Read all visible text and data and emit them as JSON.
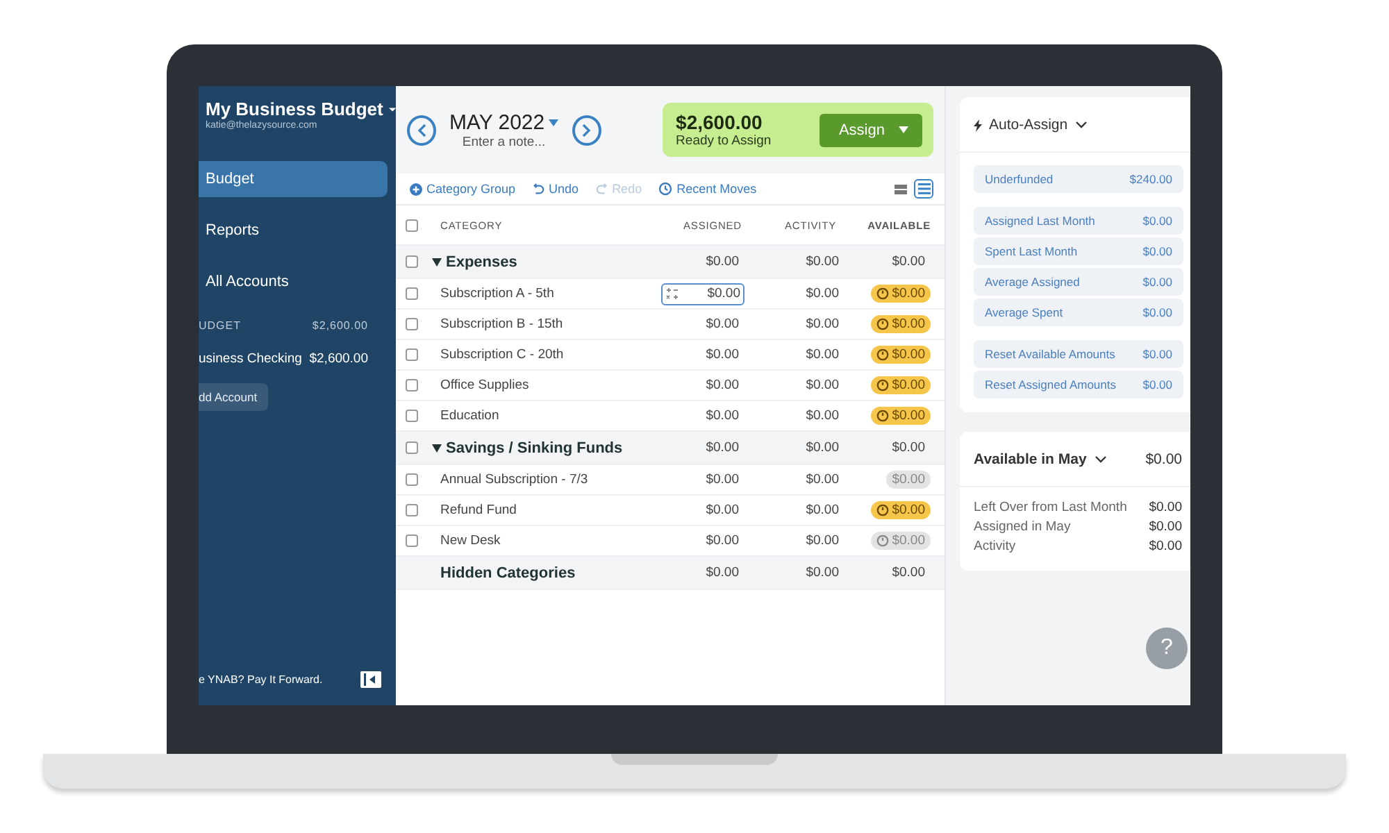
{
  "sidebar": {
    "budget_name": "My Business Budget",
    "email": "katie@thelazysource.com",
    "nav": [
      {
        "label": "Budget",
        "selected": true
      },
      {
        "label": "Reports",
        "selected": false
      },
      {
        "label": "All Accounts",
        "selected": false
      }
    ],
    "section": {
      "label": "UDGET",
      "amount": "$2,600.00"
    },
    "accounts": [
      {
        "name": "usiness Checking",
        "balance": "$2,600.00"
      }
    ],
    "add_account": "dd Account",
    "footer": "e YNAB? Pay It Forward."
  },
  "header": {
    "month": "MAY 2022",
    "note_placeholder": "Enter a note...",
    "ready_amount": "$2,600.00",
    "ready_label": "Ready to Assign",
    "assign_button": "Assign"
  },
  "toolbar": {
    "actions": [
      {
        "kind": "add",
        "label": "Category Group",
        "disabled": false
      },
      {
        "kind": "undo",
        "label": "Undo",
        "disabled": false
      },
      {
        "kind": "redo",
        "label": "Redo",
        "disabled": true
      },
      {
        "kind": "history",
        "label": "Recent Moves",
        "disabled": false
      }
    ],
    "view_toggles": [
      {
        "selected": false
      },
      {
        "selected": true
      }
    ]
  },
  "table": {
    "select_all_checked": false,
    "columns": [
      "CATEGORY",
      "ASSIGNED",
      "ACTIVITY",
      "AVAILABLE"
    ],
    "groups": [
      {
        "name": "Expenses",
        "expanded": true,
        "checked": false,
        "assigned": "$0.00",
        "activity": "$0.00",
        "available": "$0.00",
        "rows": [
          {
            "name": "Subscription A - 5th",
            "checked": false,
            "editing": true,
            "assigned": "$0.00",
            "activity": "$0.00",
            "available": "$0.00",
            "kind": "warning"
          },
          {
            "name": "Subscription B - 15th",
            "checked": false,
            "editing": false,
            "assigned": "$0.00",
            "activity": "$0.00",
            "available": "$0.00",
            "kind": "warning"
          },
          {
            "name": "Subscription C - 20th",
            "checked": false,
            "editing": false,
            "assigned": "$0.00",
            "activity": "$0.00",
            "available": "$0.00",
            "kind": "warning"
          },
          {
            "name": "Office Supplies",
            "checked": false,
            "editing": false,
            "assigned": "$0.00",
            "activity": "$0.00",
            "available": "$0.00",
            "kind": "warning"
          },
          {
            "name": "Education",
            "checked": false,
            "editing": false,
            "assigned": "$0.00",
            "activity": "$0.00",
            "available": "$0.00",
            "kind": "warning"
          }
        ]
      },
      {
        "name": "Savings / Sinking Funds",
        "expanded": true,
        "checked": false,
        "assigned": "$0.00",
        "activity": "$0.00",
        "available": "$0.00",
        "rows": [
          {
            "name": "Annual Subscription - 7/3",
            "checked": false,
            "editing": false,
            "assigned": "$0.00",
            "activity": "$0.00",
            "available": "$0.00",
            "kind": "muted"
          },
          {
            "name": "Refund Fund",
            "checked": false,
            "editing": false,
            "assigned": "$0.00",
            "activity": "$0.00",
            "available": "$0.00",
            "kind": "warning"
          },
          {
            "name": "New Desk",
            "checked": false,
            "editing": false,
            "assigned": "$0.00",
            "activity": "$0.00",
            "available": "$0.00",
            "kind": "muted-timer"
          }
        ]
      }
    ],
    "hidden": {
      "name": "Hidden Categories",
      "assigned": "$0.00",
      "activity": "$0.00",
      "available": "$0.00"
    }
  },
  "auto_assign": {
    "title": "Auto-Assign",
    "groups": [
      [
        {
          "label": "Underfunded",
          "amount": "$240.00"
        }
      ],
      [
        {
          "label": "Assigned Last Month",
          "amount": "$0.00"
        },
        {
          "label": "Spent Last Month",
          "amount": "$0.00"
        },
        {
          "label": "Average Assigned",
          "amount": "$0.00"
        },
        {
          "label": "Average Spent",
          "amount": "$0.00"
        }
      ],
      [
        {
          "label": "Reset Available Amounts",
          "amount": "$0.00"
        },
        {
          "label": "Reset Assigned Amounts",
          "amount": "$0.00"
        }
      ]
    ]
  },
  "available": {
    "title": "Available in May",
    "amount": "$0.00",
    "lines": [
      {
        "label": "Left Over from Last Month",
        "amount": "$0.00"
      },
      {
        "label": "Assigned in May",
        "amount": "$0.00"
      },
      {
        "label": "Activity",
        "amount": "$0.00"
      }
    ],
    "help": "?"
  }
}
